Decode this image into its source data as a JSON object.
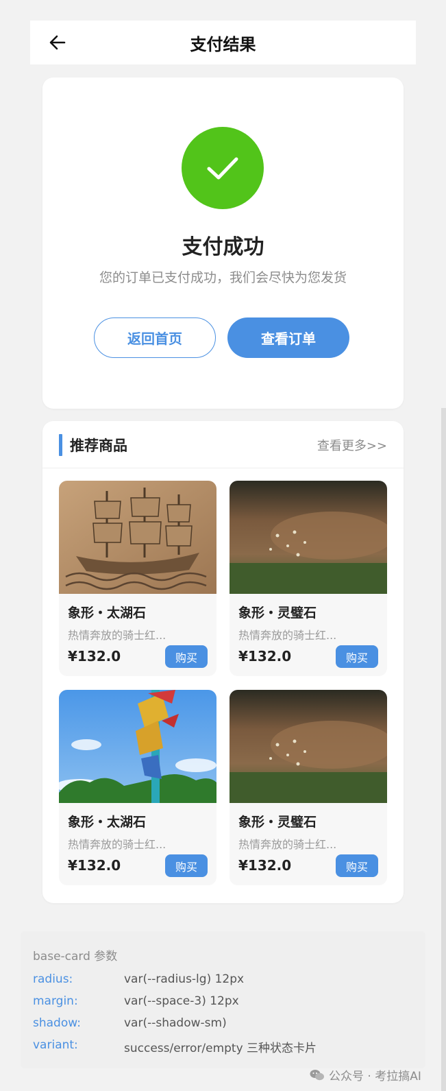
{
  "header": {
    "title": "支付结果"
  },
  "result": {
    "title": "支付成功",
    "description": "您的订单已支付成功，我们会尽快为您发货",
    "back_home_label": "返回首页",
    "view_order_label": "查看订单",
    "success_color": "#52c41a"
  },
  "recommend": {
    "title": "推荐商品",
    "more_label": "查看更多>>",
    "products": [
      {
        "name": "象形・太湖石",
        "desc": "热情奔放的骑士红...",
        "price": "¥132.0",
        "buy_label": "购买"
      },
      {
        "name": "象形・灵璧石",
        "desc": "热情奔放的骑士红...",
        "price": "¥132.0",
        "buy_label": "购买"
      },
      {
        "name": "象形・太湖石",
        "desc": "热情奔放的骑士红...",
        "price": "¥132.0",
        "buy_label": "购买"
      },
      {
        "name": "象形・灵璧石",
        "desc": "热情奔放的骑士红...",
        "price": "¥132.0",
        "buy_label": "购买"
      }
    ]
  },
  "params": {
    "title": "base-card 参数",
    "rows": [
      {
        "key": "radius:",
        "value": "var(--radius-lg) 12px"
      },
      {
        "key": "margin:",
        "value": "var(--space-3) 12px"
      },
      {
        "key": "shadow:",
        "value": "var(--shadow-sm)"
      },
      {
        "key": "variant:",
        "value": "success/error/empty 三种状态卡片"
      }
    ]
  },
  "watermark": {
    "text": "公众号 · 考拉搞AI"
  },
  "colors": {
    "accent": "#4a90e2",
    "success": "#52c41a",
    "background": "#f2f2f2"
  },
  "icons": {
    "back": "arrow-left-icon",
    "success": "checkmark-icon",
    "watermark": "wechat-icon"
  }
}
